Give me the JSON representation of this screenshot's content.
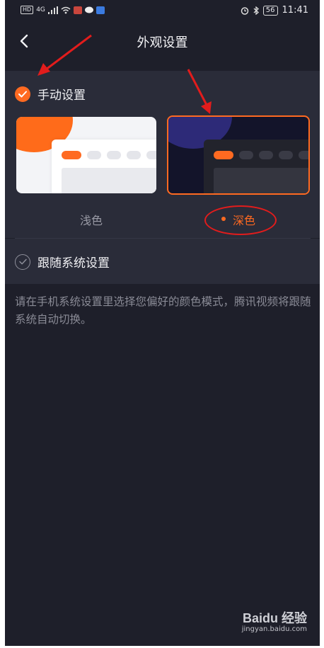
{
  "status_bar": {
    "left_badges": [
      "HD",
      "4G"
    ],
    "battery": "56",
    "time": "11:41"
  },
  "nav": {
    "title": "外观设置"
  },
  "manual": {
    "label": "手动设置",
    "checked": true,
    "options": [
      {
        "label": "浅色",
        "selected": false
      },
      {
        "label": "深色",
        "selected": true
      }
    ]
  },
  "follow": {
    "label": "跟随系统设置",
    "checked": false
  },
  "description": "请在手机系统设置里选择您偏好的颜色模式，腾讯视频将跟随系统自动切换。",
  "watermark": {
    "logo": "Baidu 经验",
    "url": "jingyan.baidu.com"
  },
  "colors": {
    "accent": "#ff6a21",
    "background": "#1e1f2a",
    "section": "#2a2c39",
    "annotation": "#e21c1c"
  }
}
